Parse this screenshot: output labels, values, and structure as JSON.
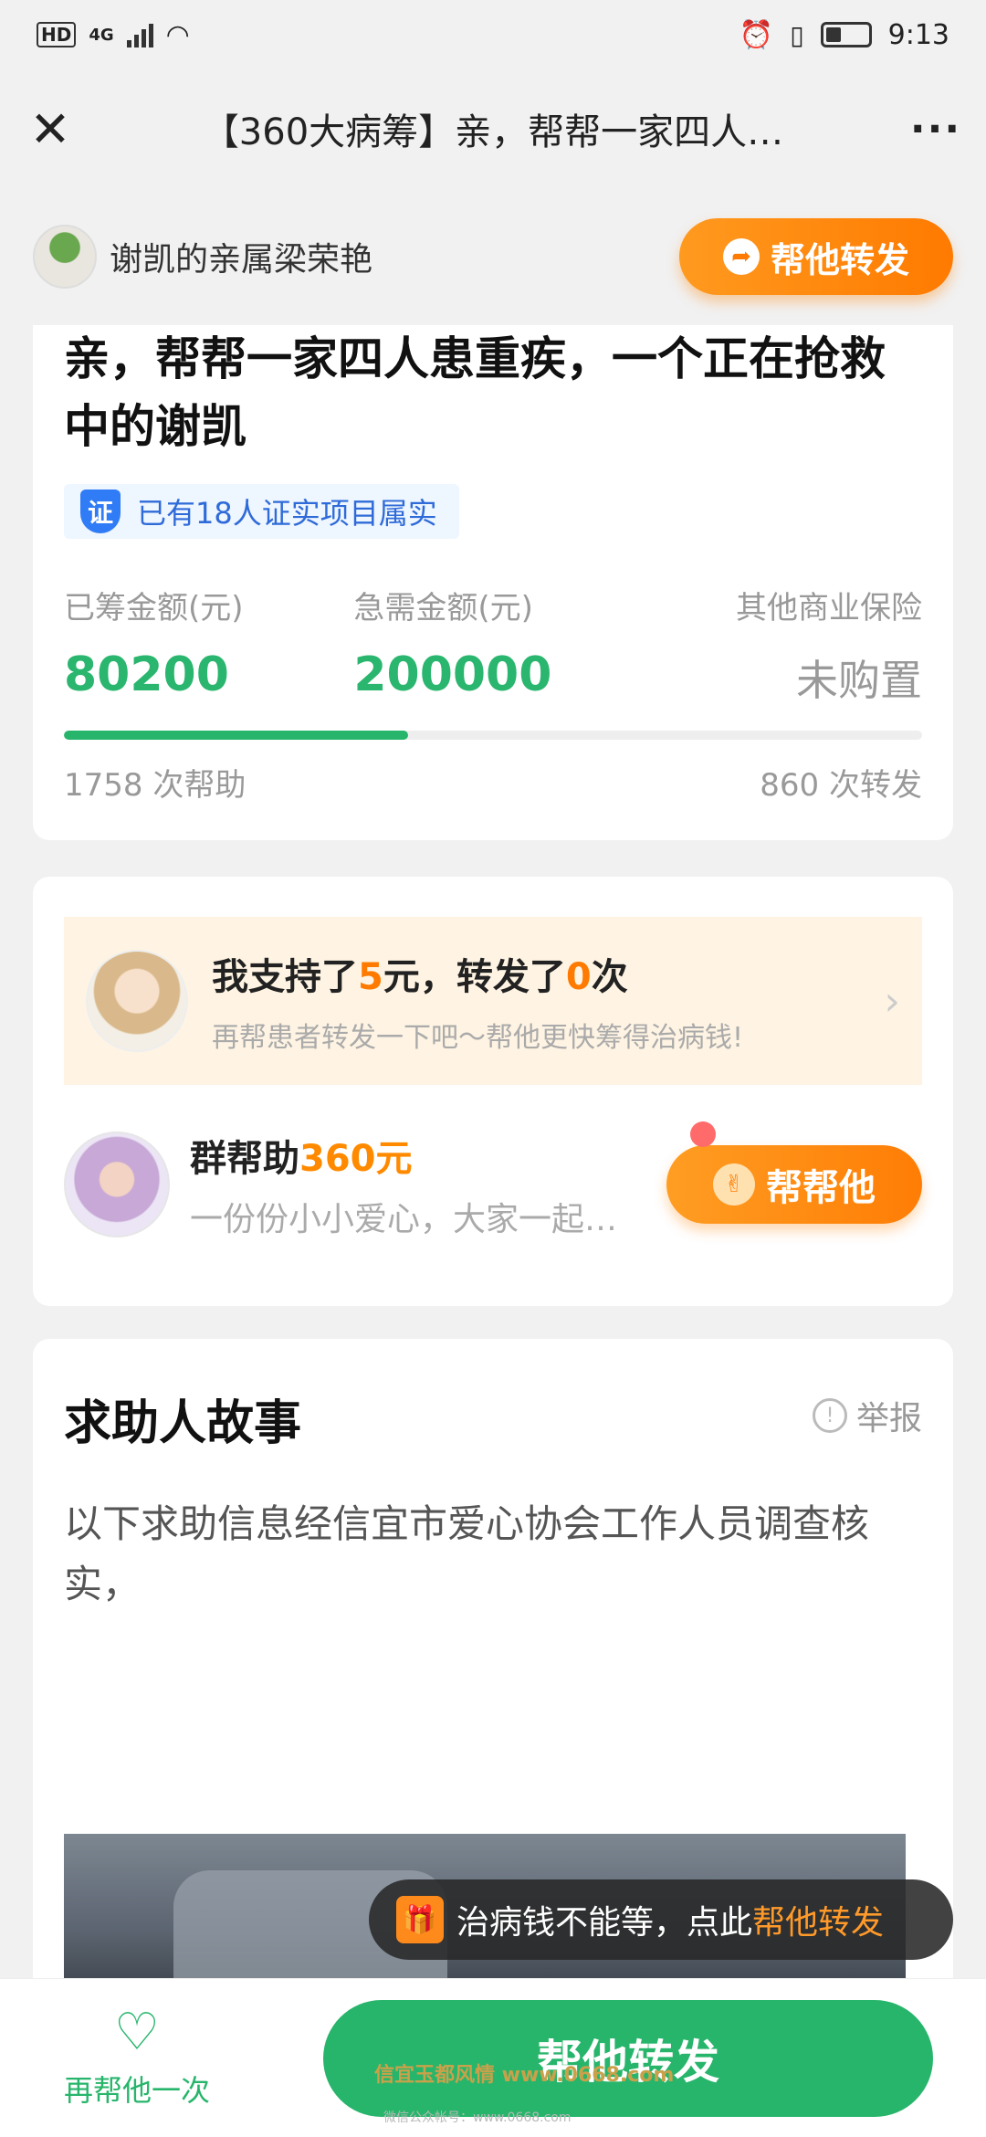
{
  "status_bar": {
    "left": "HD 4G",
    "time": "9:13"
  },
  "nav": {
    "title": "【360大病筹】亲，帮帮一家四人…",
    "close_icon": "close-icon",
    "more_icon": "more-icon"
  },
  "header": {
    "relative_name": "谢凯的亲属梁荣艳",
    "forward_label": "帮他转发"
  },
  "campaign": {
    "title": "亲，帮帮一家四人患重疾，一个正在抢救中的谢凯",
    "verify_badge_icon": "证",
    "verify_text": "已有18人证实项目属实",
    "stats": [
      {
        "label": "已筹金额(元)",
        "value": "80200"
      },
      {
        "label": "急需金额(元)",
        "value": "200000"
      },
      {
        "label": "其他商业保险",
        "value": "未购置"
      }
    ],
    "progress_fraction": 0.401,
    "help_count": "1758 次帮助",
    "forward_count": "860 次转发"
  },
  "support": {
    "line_prefix": "我支持了",
    "amount": "5",
    "line_mid": "元，转发了",
    "times": "0",
    "line_suffix": "次",
    "sub": "再帮患者转发一下吧～帮他更快筹得治病钱!",
    "group_prefix": "群帮助",
    "group_amount": "360元",
    "group_sub": "一份份小小爱心，大家一起…",
    "help_btn": "帮帮他"
  },
  "story": {
    "title": "求助人故事",
    "report_label": "举报",
    "body": "以下求助信息经信宜市爱心协会工作人员调查核实，"
  },
  "toast": {
    "text": "治病钱不能等，点此",
    "highlight": "帮他转发"
  },
  "bottom": {
    "again_label": "再帮他一次",
    "share_label": "帮他转发",
    "watermark": "信宜玉都风情 www.0668.com",
    "watermark_small": "微信公众帐号：www.0668.com"
  },
  "colors": {
    "accent_green": "#27b56b",
    "accent_orange": "#ff7a00"
  }
}
